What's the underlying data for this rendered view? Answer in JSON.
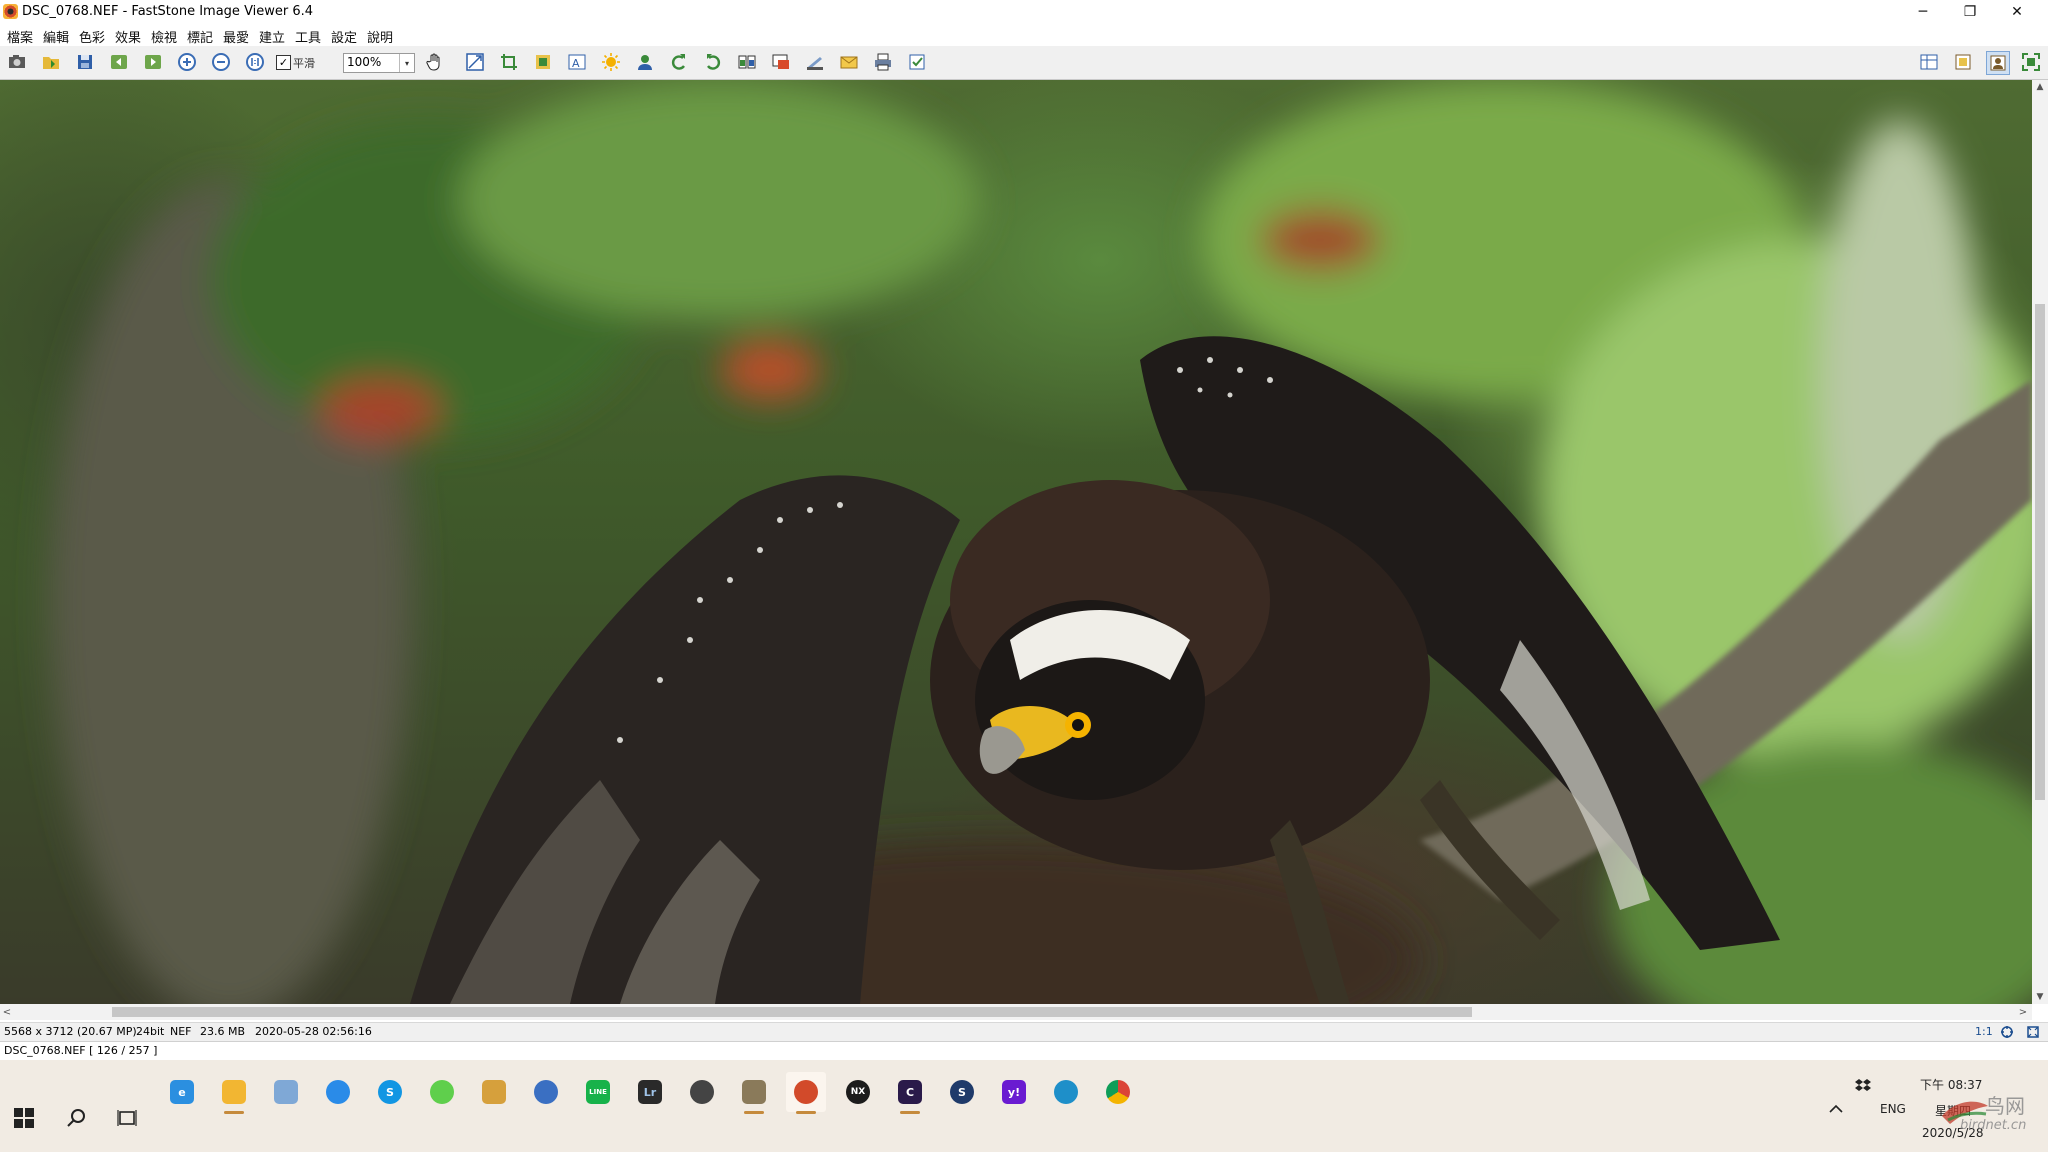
{
  "window": {
    "title": "DSC_0768.NEF  -  FastStone Image Viewer 6.4",
    "minimize": "─",
    "restore": "❐",
    "close": "✕"
  },
  "menu": [
    "檔案",
    "編輯",
    "色彩",
    "效果",
    "檢視",
    "標記",
    "最愛",
    "建立",
    "工具",
    "設定",
    "說明"
  ],
  "toolbar": {
    "smooth_label": "平滑",
    "smooth_checked": "✓",
    "zoom_value": "100%",
    "zoom_arrow": "▾",
    "buttons": [
      "open-icon",
      "browse-icon",
      "save-icon",
      "previous-icon",
      "next-icon",
      "zoom-in-icon",
      "zoom-out-icon",
      "actual-size-icon"
    ],
    "tools": [
      "resize-icon",
      "crop-icon",
      "canvas-icon",
      "text-icon",
      "brightness-icon",
      "color-icon",
      "rotate-left-icon",
      "rotate-right-icon",
      "compare-icon",
      "slideshow-icon",
      "scanner-icon",
      "email-icon",
      "print-icon",
      "properties-icon"
    ],
    "view_modes": [
      "browser-mode-icon",
      "windowed-mode-icon",
      "full-screen-icon",
      "fit-window-icon"
    ]
  },
  "status": {
    "dimensions": "5568 x 3712 (20.67 MP)",
    "bitdepth": "24bit",
    "format": "NEF",
    "filesize": "23.6 MB",
    "datetime": "2020-05-28 02:56:16",
    "zoom_ratio": "1:1"
  },
  "file_info": "DSC_0768.NEF [ 126 / 257 ]",
  "taskbar": {
    "apps": [
      {
        "name": "ie-icon",
        "label": "e",
        "color": "#2b8fe0"
      },
      {
        "name": "file-explorer-icon",
        "label": "",
        "color": "#f2b632"
      },
      {
        "name": "notepad-icon",
        "label": "",
        "color": "#7fa8d6"
      },
      {
        "name": "onedrive-icon",
        "label": "",
        "color": "#2a8be8"
      },
      {
        "name": "skype-icon",
        "label": "S",
        "color": "#1296e3"
      },
      {
        "name": "wechat-icon",
        "label": "",
        "color": "#5fcf4c"
      },
      {
        "name": "photo-app-icon",
        "label": "",
        "color": "#d6a03c"
      },
      {
        "name": "browser-globe-icon",
        "label": "",
        "color": "#3a6fc2"
      },
      {
        "name": "line-icon",
        "label": "LINE",
        "color": "#17b24a"
      },
      {
        "name": "lightroom-icon",
        "label": "Lr",
        "color": "#2a2a2a"
      },
      {
        "name": "camera-app-icon",
        "label": "",
        "color": "#444444"
      },
      {
        "name": "clapper-icon",
        "label": "",
        "color": "#8a7a5a"
      },
      {
        "name": "faststone-icon",
        "label": "",
        "color": "#d24a2a"
      },
      {
        "name": "nx-studio-icon",
        "label": "NX",
        "color": "#1c1c1c"
      },
      {
        "name": "capture-app-icon",
        "label": "C",
        "color": "#2a1a4a"
      },
      {
        "name": "shield-app-icon",
        "label": "S",
        "color": "#1f3a6a"
      },
      {
        "name": "yahoo-icon",
        "label": "y!",
        "color": "#6a1bd1"
      },
      {
        "name": "edge-icon",
        "label": "",
        "color": "#1e8fc9"
      },
      {
        "name": "chrome-icon",
        "label": "",
        "color": "#db4437"
      }
    ],
    "tray": {
      "language": "ENG",
      "time": "下午 08:37",
      "weekday": "星期四",
      "date": "2020/5/28",
      "watermark": "鸟网",
      "watermark_url": "birdnet.cn"
    }
  }
}
